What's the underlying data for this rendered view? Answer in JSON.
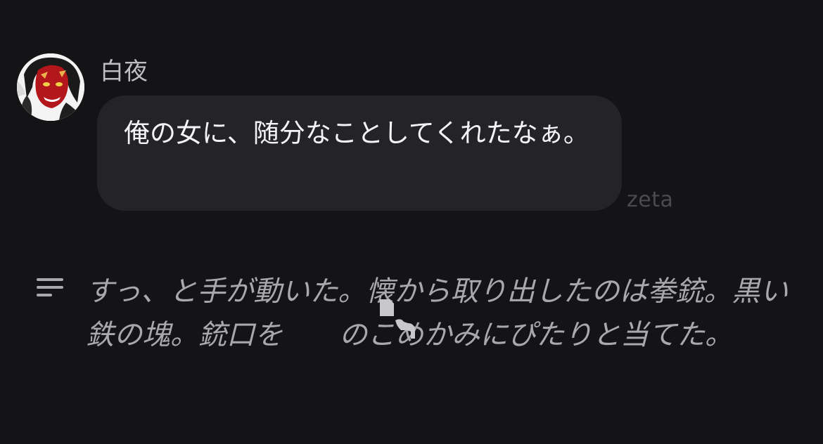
{
  "message": {
    "sender_name": "白夜",
    "text": "俺の女に、随分なことしてくれたなぁ。"
  },
  "watermark": "zeta",
  "narration": {
    "icon": "text-lines-icon",
    "text": "すっ、と手が動いた。懐から取り出したのは拳銃。黒い鉄の塊。銃口を　　のこめかみにぴたりと当てた。"
  },
  "colors": {
    "background": "#141416",
    "bubble": "#242427",
    "message_text": "#f4f4f6",
    "narration_text": "#a9a9ad",
    "name_text": "#bdbdc2",
    "watermark": "#4a4a50"
  }
}
